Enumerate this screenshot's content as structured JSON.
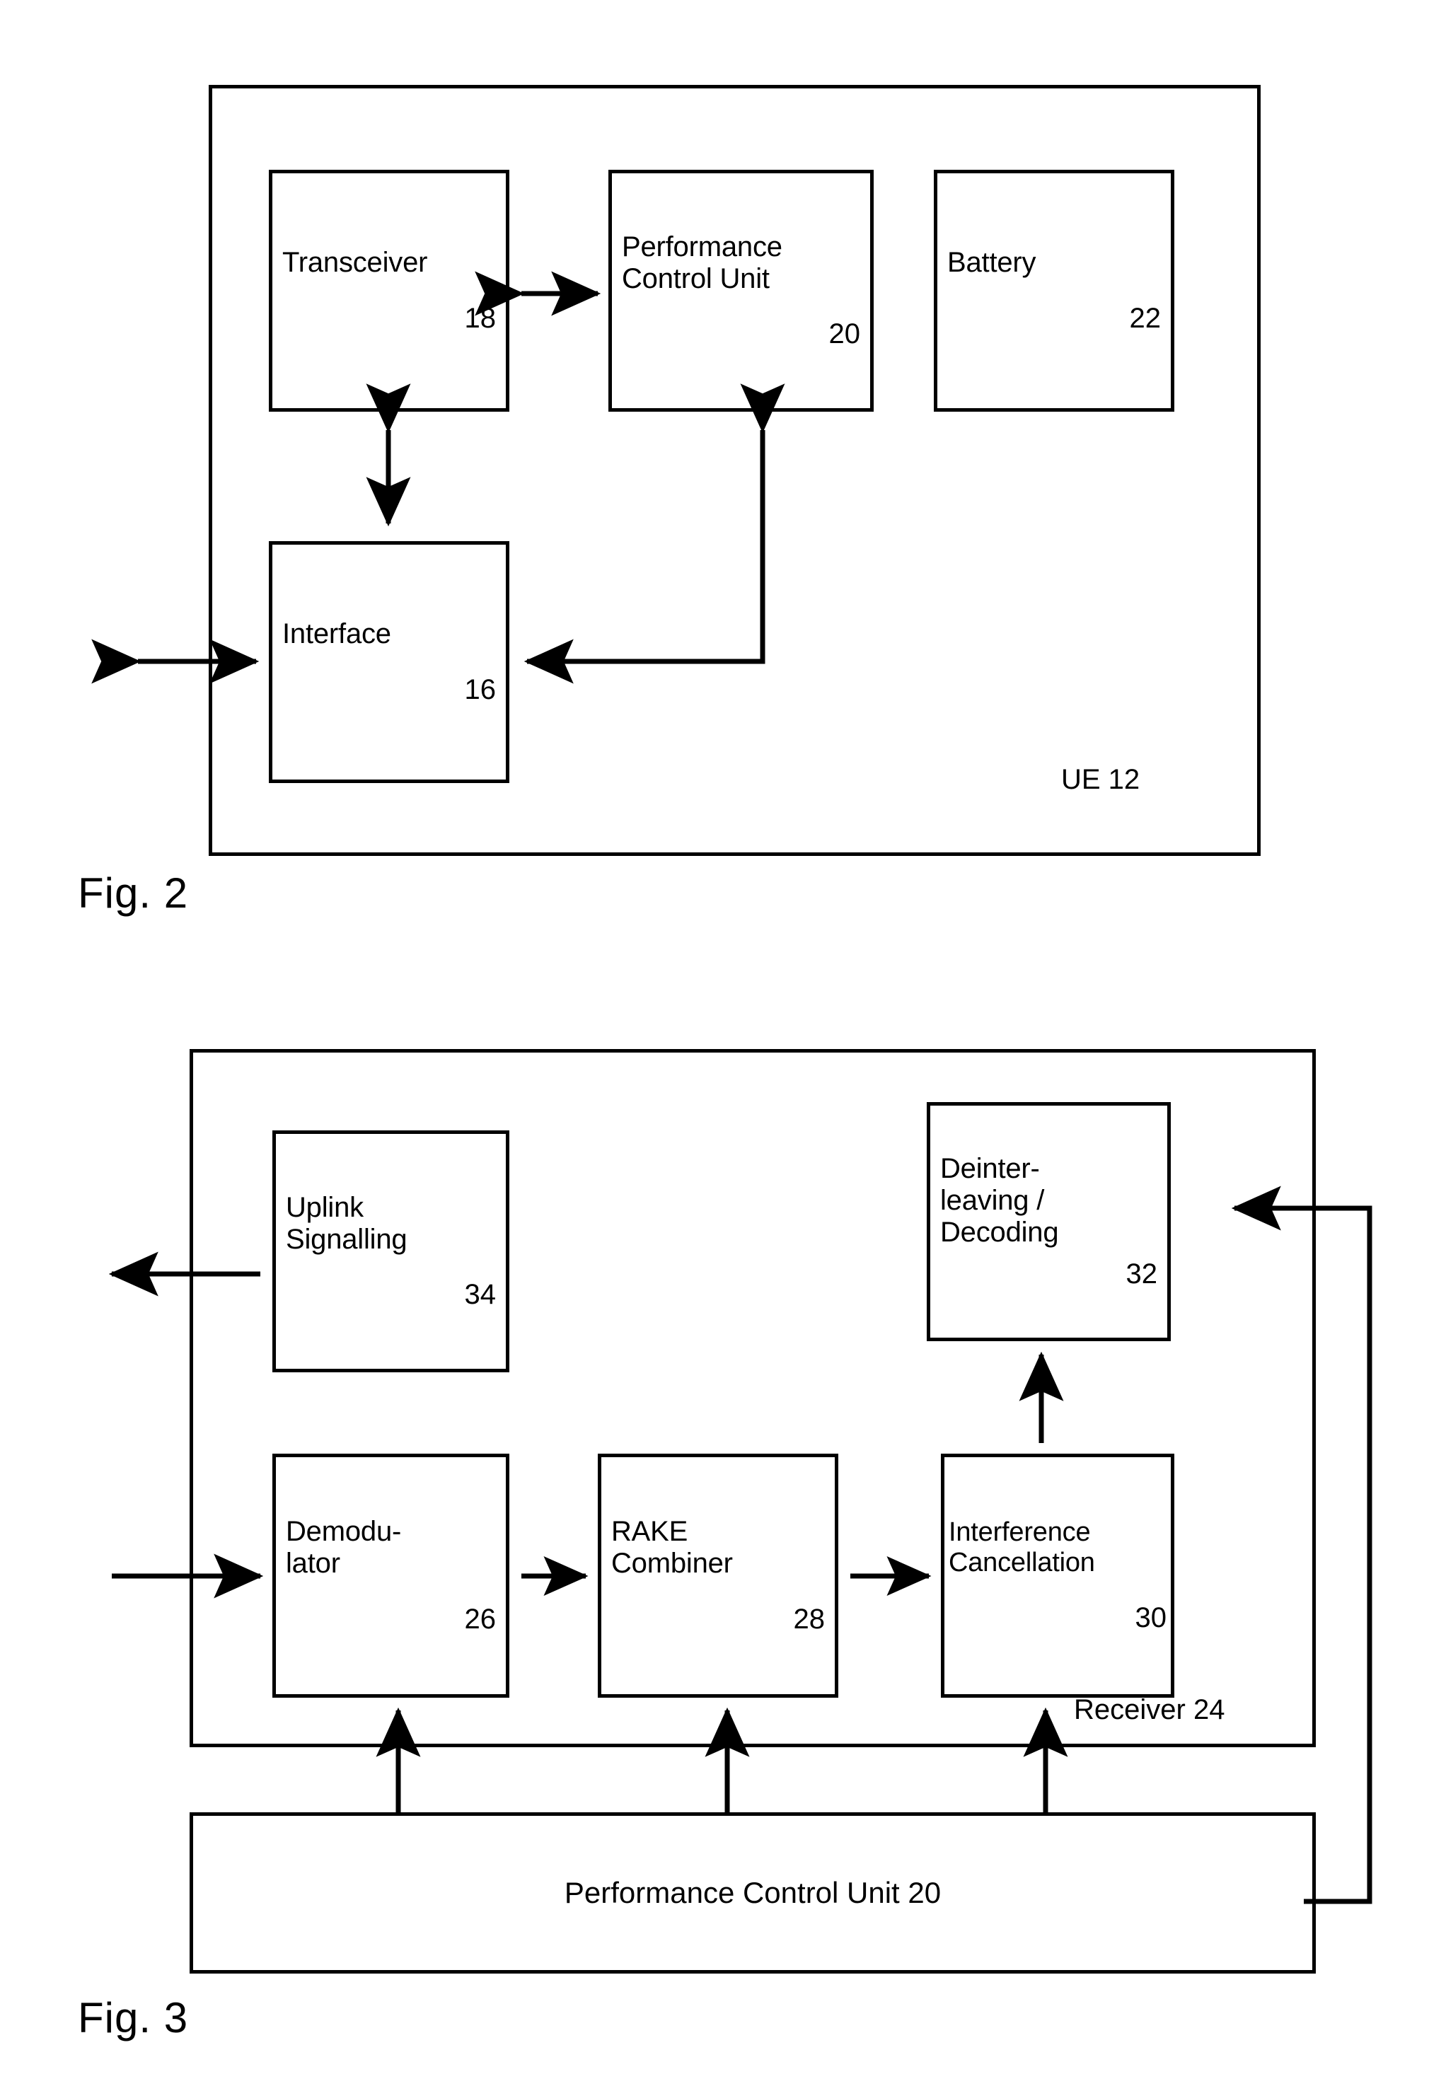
{
  "document": {
    "type": "patent-drawing-sheet",
    "figures": [
      {
        "id": "fig2",
        "caption": "Fig. 2",
        "frame_tag": "UE 12",
        "blocks": [
          {
            "key": "transceiver",
            "label": "Transceiver",
            "number": "18"
          },
          {
            "key": "performance_control_unit",
            "label": "Performance\nControl Unit",
            "number": "20"
          },
          {
            "key": "battery",
            "label": "Battery",
            "number": "22"
          },
          {
            "key": "interface",
            "label": "Interface",
            "number": "16"
          }
        ]
      },
      {
        "id": "fig3",
        "caption": "Fig. 3",
        "frame_tag": "Receiver 24",
        "blocks": [
          {
            "key": "uplink_signalling",
            "label": "Uplink\nSignalling",
            "number": "34"
          },
          {
            "key": "deinterleaving_decoding",
            "label": "Deinter-\nleaving /\nDecoding",
            "number": "32"
          },
          {
            "key": "demodulator",
            "label": "Demodu-\nlator",
            "number": "26"
          },
          {
            "key": "rake_combiner",
            "label": "RAKE\nCombiner",
            "number": "28"
          },
          {
            "key": "interference_cancellation",
            "label": "Interference\nCancellation",
            "number": "30"
          }
        ],
        "bar_block": {
          "key": "performance_control_unit_bar",
          "label": "Performance Control Unit 20"
        }
      }
    ],
    "colors": {
      "ink": "#000000",
      "paper": "#ffffff"
    }
  }
}
